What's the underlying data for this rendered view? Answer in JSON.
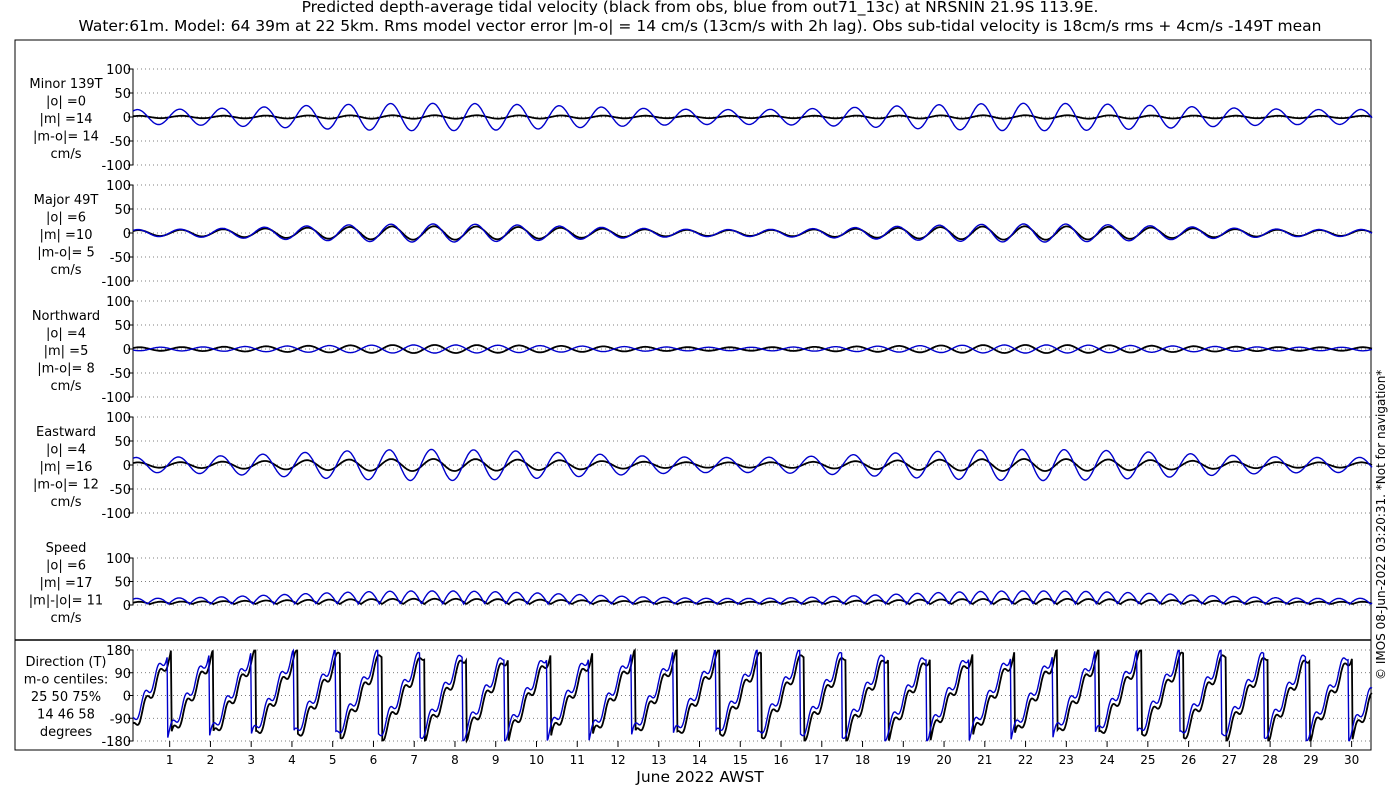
{
  "title_line1": "Predicted depth-average tidal velocity (black from obs, blue from out71_13c) at NRSNIN 21.9S 113.9E.",
  "title_line2": "Water:61m. Model: 64 39m at 22 5km. Rms model vector error |m-o| = 14 cm/s (13cm/s with 2h lag). Obs sub-tidal velocity is 18cm/s rms + 4cm/s -149T mean",
  "xlabel": "June 2022 AWST",
  "credit": "© IMOS 08-Jun-2022 03:20:31. *Not for navigation*",
  "colors": {
    "obs": "#000000",
    "model": "#0000cc",
    "grid": "#555555"
  },
  "chart_data": [
    {
      "type": "line",
      "label": [
        "Minor 139T",
        "|o| =0",
        "|m| =14",
        "|m-o|= 14",
        "cm/s"
      ],
      "ylim": [
        -100,
        100
      ],
      "yticks": [
        "100",
        "50",
        "0",
        "-50",
        "-100"
      ],
      "yvals": [
        100,
        50,
        0,
        -50,
        -100
      ],
      "series": [
        {
          "amplitude": 3,
          "phase": 0.0,
          "spring_neap": 0.2
        },
        {
          "amplitude": 22,
          "phase": 0.3,
          "spring_neap": 0.3
        }
      ]
    },
    {
      "type": "line",
      "label": [
        "Major 49T",
        "|o| =6",
        "|m| =10",
        "|m-o|= 5",
        "cm/s"
      ],
      "ylim": [
        -100,
        100
      ],
      "yticks": [
        "100",
        "50",
        "0",
        "-50",
        "-100"
      ],
      "yvals": [
        100,
        50,
        0,
        -50,
        -100
      ],
      "series": [
        {
          "amplitude": 10,
          "phase": 0.1,
          "spring_neap": 0.4
        },
        {
          "amplitude": 13,
          "phase": 0.25,
          "spring_neap": 0.45
        }
      ]
    },
    {
      "type": "line",
      "label": [
        "Northward",
        "|o| =4",
        "|m| =5",
        "|m-o|= 8",
        "cm/s"
      ],
      "ylim": [
        -100,
        100
      ],
      "yticks": [
        "100",
        "50",
        "0",
        "-50",
        "-100"
      ],
      "yvals": [
        100,
        50,
        0,
        -50,
        -100
      ],
      "series": [
        {
          "amplitude": 6,
          "phase": 0.0,
          "spring_neap": 0.4
        },
        {
          "amplitude": 6,
          "phase": 3.14,
          "spring_neap": 0.4
        }
      ]
    },
    {
      "type": "line",
      "label": [
        "Eastward",
        "|o| =4",
        "|m| =16",
        "|m-o|= 12",
        "cm/s"
      ],
      "ylim": [
        -100,
        100
      ],
      "yticks": [
        "100",
        "50",
        "0",
        "-50",
        "-100"
      ],
      "yvals": [
        100,
        50,
        0,
        -50,
        -100
      ],
      "series": [
        {
          "amplitude": 9,
          "phase": 0.2,
          "spring_neap": 0.4
        },
        {
          "amplitude": 24,
          "phase": 0.5,
          "spring_neap": 0.35
        }
      ]
    },
    {
      "type": "line",
      "label": [
        "Speed",
        "|o| =6",
        "|m| =17",
        "|m|-|o|= 11",
        "cm/s"
      ],
      "ylim": [
        0,
        100
      ],
      "yticks": [
        "100",
        "50",
        "0"
      ],
      "yvals": [
        100,
        50,
        0
      ],
      "series": [
        {
          "amplitude": 8,
          "phase": 0.0,
          "spring_neap": 0.4,
          "positive": true
        },
        {
          "amplitude": 20,
          "phase": 0.4,
          "spring_neap": 0.4,
          "positive": true
        }
      ]
    },
    {
      "type": "line",
      "label": [
        "Direction (T)",
        "m-o centiles:",
        "25  50  75%",
        "14  46  58",
        "degrees"
      ],
      "ylim": [
        -180,
        180
      ],
      "yticks": [
        "180",
        "90",
        "0",
        "-90",
        "-180"
      ],
      "yvals": [
        180,
        90,
        0,
        -90,
        -180
      ],
      "series": [
        {
          "direction": true,
          "phase": 0.0
        },
        {
          "direction": true,
          "phase": 0.6
        }
      ]
    }
  ],
  "xaxis": {
    "range": [
      0.1,
      30.5
    ],
    "days": [
      "1",
      "2",
      "3",
      "4",
      "5",
      "6",
      "7",
      "8",
      "9",
      "10",
      "11",
      "12",
      "13",
      "14",
      "15",
      "16",
      "17",
      "18",
      "19",
      "20",
      "21",
      "22",
      "23",
      "24",
      "25",
      "26",
      "27",
      "28",
      "29",
      "30"
    ]
  }
}
